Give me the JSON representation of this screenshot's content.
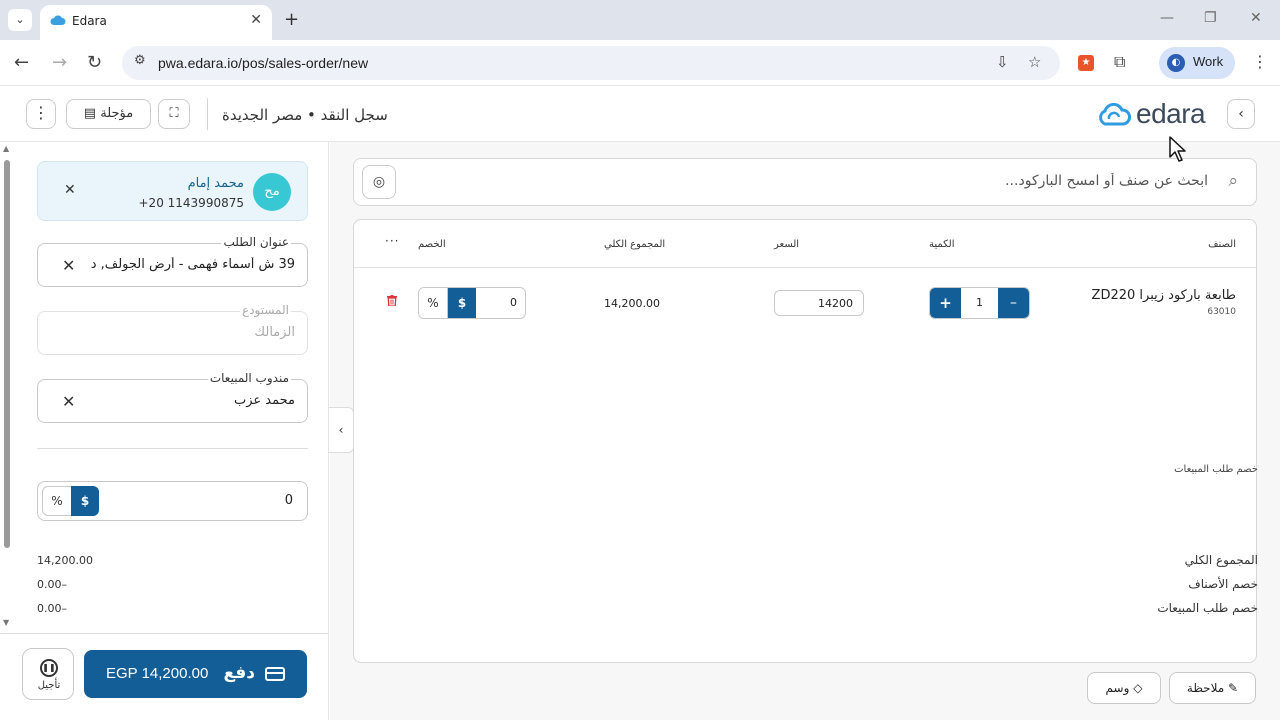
{
  "browser": {
    "tab_title": "Edara",
    "url": "pwa.edara.io/pos/sales-order/new",
    "profile_label": "Work"
  },
  "header": {
    "title": "سجل النقد • مصر الجديدة",
    "deferred_label": "مؤجلة",
    "logo_text": "edara"
  },
  "customer": {
    "initials": "مح",
    "name": "محمد إمام",
    "phone": "+20 1143990875"
  },
  "fields": {
    "address_label": "عنوان الطلب",
    "address_value": "39 ش أسماء فهمى - أرض الجولف, د",
    "warehouse_label": "المستودع",
    "warehouse_value": "الزمالك",
    "salesrep_label": "مندوب المبيعات",
    "salesrep_value": "محمد عزب"
  },
  "order_discount": {
    "label": "خصم طلب المبيعات",
    "value": "0",
    "pct_symbol": "%",
    "usd_symbol": "$"
  },
  "summary": {
    "total_label": "المجموع الكلي",
    "total_value": "14,200.00",
    "items_discount_label": "خصم الأصناف",
    "items_discount_value": "0.00–",
    "order_discount_label": "خصم طلب المبيعات",
    "order_discount_value": "0.00–"
  },
  "footer": {
    "defer_label": "تأجيل",
    "pay_label": "دفع",
    "pay_amount": "EGP 14,200.00"
  },
  "search": {
    "placeholder": "ابحث عن صنف أو امسح الباركود..."
  },
  "table": {
    "columns": {
      "item": "الصنف",
      "qty": "الكمية",
      "price": "السعر",
      "total": "المجموع الكلي",
      "discount": "الخصم"
    },
    "rows": [
      {
        "name": "طابعة باركود زيبرا ZD220",
        "code": "63010",
        "qty": "1",
        "price": "14200",
        "total": "14,200.00",
        "discount": "0"
      }
    ]
  },
  "actions": {
    "tag_label": "وسم",
    "note_label": "ملاحظة"
  },
  "colors": {
    "primary": "#135e96",
    "avatar": "#37c8d3",
    "danger": "#d9363e"
  }
}
